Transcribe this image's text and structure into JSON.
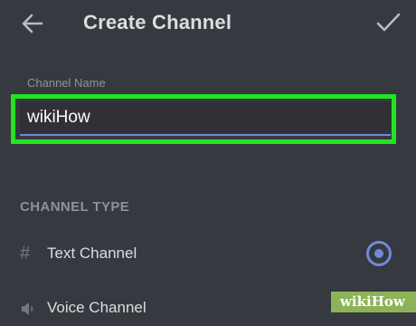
{
  "header": {
    "back_icon": "arrow-left-icon",
    "title": "Create Channel",
    "confirm_icon": "checkmark-icon"
  },
  "form": {
    "channel_name_label": "Channel Name",
    "channel_name_value": "wikiHow"
  },
  "channel_type": {
    "section_title": "CHANNEL TYPE",
    "options": [
      {
        "icon": "hash-icon",
        "glyph": "#",
        "label": "Text Channel",
        "selected": true
      },
      {
        "icon": "speaker-icon",
        "glyph": "🔈",
        "label": "Voice Channel",
        "selected": false
      }
    ]
  },
  "watermark": {
    "text": "wikiHow"
  },
  "colors": {
    "background": "#36393f",
    "input_background": "#2f3136",
    "accent": "#7289da",
    "highlight": "#22e51f"
  }
}
